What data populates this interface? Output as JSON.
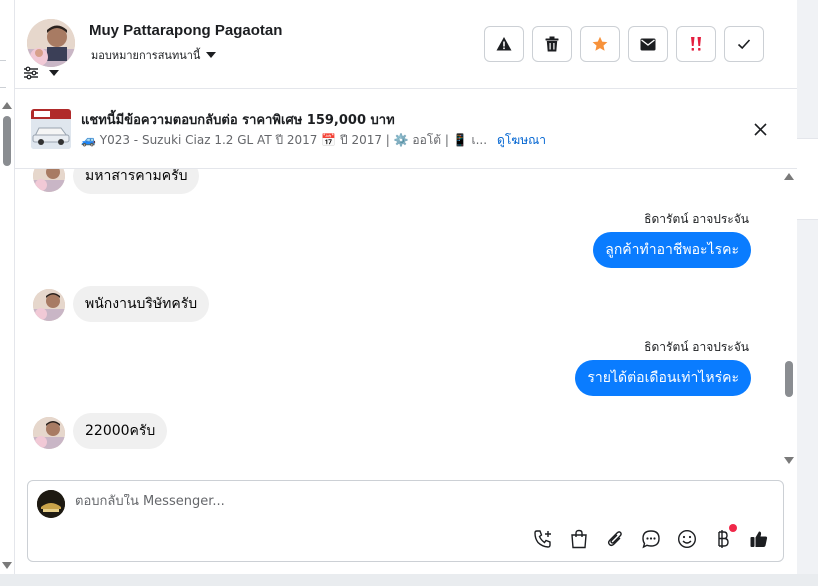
{
  "header": {
    "name": "Muy Pattarapong Pagaotan",
    "assign_label": "มอบหมายการสนทนานี้",
    "actions": [
      {
        "name": "report-button",
        "icon": "warning-triangle-icon",
        "color": "#1c1e21"
      },
      {
        "name": "delete-button",
        "icon": "trash-icon",
        "color": "#1c1e21"
      },
      {
        "name": "star-button",
        "icon": "star-icon",
        "color": "#f7923b"
      },
      {
        "name": "mark-unread-button",
        "icon": "envelope-icon",
        "color": "#1c1e21"
      },
      {
        "name": "follow-up-button",
        "icon": "double-exclamation-icon",
        "color": "#e41e3f"
      },
      {
        "name": "mark-done-button",
        "icon": "checkmark-icon",
        "color": "#1c1e21"
      }
    ]
  },
  "banner": {
    "title": "แชทนี้มีข้อความตอบกลับต่อ ราคาพิเศษ 159,000 บาท",
    "subtitle": "🚙 Y023 - Suzuki Ciaz 1.2 GL AT ปี 2017 📅 ปี 2017 | ⚙️ ออโต้ | 📱 เ...",
    "see_ad": "ดูโฆษณา"
  },
  "messages": [
    {
      "direction": "in",
      "text": "มหาสารคามครับ"
    },
    {
      "direction": "out",
      "sender": "ธิดารัตน์ อาจประจัน",
      "text": "ลูกค้าทำอาชีพอะไรคะ"
    },
    {
      "direction": "in",
      "text": "พนักงานบริษัทครับ"
    },
    {
      "direction": "out",
      "sender": "ธิดารัตน์ อาจประจัน",
      "text": "รายได้ต่อเดือนเท่าไหร่คะ"
    },
    {
      "direction": "in",
      "text": "22000ครับ"
    }
  ],
  "composer": {
    "placeholder": "ตอบกลับใน Messenger...",
    "value": "",
    "tools": [
      "call-add-icon",
      "shopping-bag-icon",
      "paperclip-icon",
      "saved-reply-icon",
      "emoji-icon",
      "baht-icon",
      "thumbs-up-icon"
    ]
  },
  "colors": {
    "accent": "#0a7cff",
    "link": "#0064d1",
    "incoming_bubble": "#f0f0f0",
    "star": "#f7923b",
    "alert": "#e41e3f"
  }
}
